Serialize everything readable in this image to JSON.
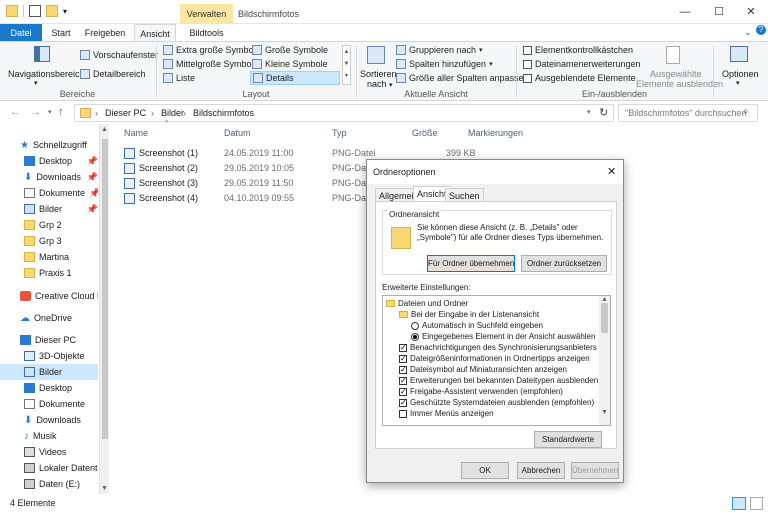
{
  "window": {
    "contextual_tab": "Verwalten",
    "title": "Bildschirmfotos",
    "controls": {
      "minimize": "—",
      "maximize": "☐",
      "close": "✕"
    }
  },
  "tabs": {
    "file": "Datei",
    "start": "Start",
    "share": "Freigeben",
    "view": "Ansicht",
    "picture_tools": "Bildtools"
  },
  "ribbon": {
    "panes": {
      "nav_pane": "Navigationsbereich",
      "preview": "Vorschaufenster",
      "details": "Detailbereich",
      "group_label": "Bereiche"
    },
    "layout": {
      "items": [
        "Extra große Symbole",
        "Große Symbole",
        "Mittelgroße Symbole",
        "Kleine Symbole",
        "Liste",
        "Details"
      ],
      "group_label": "Layout"
    },
    "current_view": {
      "sort": "Sortieren",
      "sort_sub": "nach",
      "group": "Gruppieren nach",
      "add_cols": "Spalten hinzufügen",
      "fit_cols": "Größe aller Spalten anpassen",
      "group_label": "Aktuelle Ansicht"
    },
    "show_hide": {
      "item_checkboxes": "Elementkontrollkästchen",
      "extensions": "Dateinamenerweiterungen",
      "hidden_items": "Ausgeblendete Elemente",
      "hide_selected": "Ausgewählte",
      "hide_selected_2": "Elemente ausblenden",
      "group_label": "Ein-/ausblenden"
    },
    "options": "Optionen"
  },
  "address": {
    "crumbs": [
      "Dieser PC",
      "Bilder",
      "Bildschirmfotos"
    ],
    "search_placeholder": "\"Bildschirmfotos\" durchsuchen"
  },
  "nav": {
    "quick_access": "Schnellzugriff",
    "items": [
      "Desktop",
      "Downloads",
      "Dokumente",
      "Bilder",
      "Grp 2",
      "Grp 3",
      "Martina",
      "Praxis 1"
    ],
    "creative_cloud": "Creative Cloud Fil",
    "onedrive": "OneDrive",
    "this_pc": "Dieser PC",
    "pc_items": [
      "3D-Objekte",
      "Bilder",
      "Desktop",
      "Dokumente",
      "Downloads",
      "Musik",
      "Videos",
      "Lokaler Datenträ",
      "Daten (E:)"
    ]
  },
  "columns": {
    "name": "Name",
    "date": "Datum",
    "type": "Typ",
    "size": "Größe",
    "tags": "Markierungen"
  },
  "files": [
    {
      "name": "Screenshot (1)",
      "date": "24.05.2019 11:00",
      "type": "PNG-Datei",
      "size": "399 KB"
    },
    {
      "name": "Screenshot (2)",
      "date": "29.05.2019 10:05",
      "type": "PNG-Datei",
      "size": ""
    },
    {
      "name": "Screenshot (3)",
      "date": "29.05.2019 11:50",
      "type": "PNG-Datei",
      "size": ""
    },
    {
      "name": "Screenshot (4)",
      "date": "04.10.2019 09:55",
      "type": "PNG-Datei",
      "size": ""
    }
  ],
  "status": {
    "count": "4 Elemente"
  },
  "dialog": {
    "title": "Ordneroptionen",
    "tabs": [
      "Allgemein",
      "Ansicht",
      "Suchen"
    ],
    "folder_view_label": "Ordneransicht",
    "folder_view_text_1": "Sie können diese Ansicht (z. B. „Details\" oder",
    "folder_view_text_2": "„Symbole\") für alle Ordner dieses Typs übernehmen.",
    "apply_btn": "Für Ordner übernehmen",
    "reset_btn": "Ordner zurücksetzen",
    "advanced_label": "Erweiterte Einstellungen:",
    "tree": [
      "Dateien und Ordner",
      "Bei der Eingabe in der Listenansicht",
      "Automatisch in Suchfeld eingeben",
      "Eingegebenes Element in der Ansicht auswählen",
      "Benachrichtigungen des Synchronisierungsanbieters anzeig",
      "Dateigrößeninformationen in Ordnertipps anzeigen",
      "Dateisymbol auf Miniaturansichten anzeigen",
      "Erweiterungen bei bekannten Dateitypen ausblenden",
      "Freigabe-Assistent verwenden (empfohlen)",
      "Geschützte Systemdateien ausblenden (empfohlen)",
      "Immer Menüs anzeigen"
    ],
    "defaults_btn": "Standardwerte",
    "ok": "OK",
    "cancel": "Abbrechen",
    "apply": "Übernehmen"
  },
  "colors": {
    "accent": "#1979ca",
    "selection": "#cce8ff",
    "folder": "#f8d775"
  }
}
